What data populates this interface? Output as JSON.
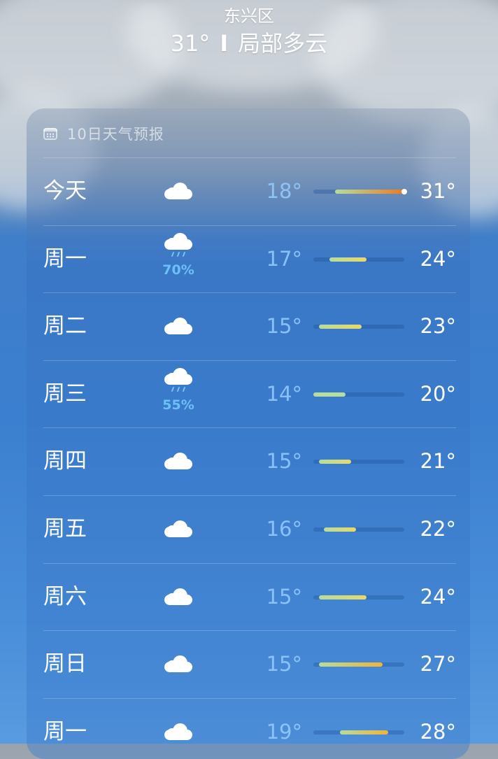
{
  "header": {
    "location": "东兴区",
    "current_temp": "31°",
    "separator": "I",
    "condition": "局部多云"
  },
  "forecast_card": {
    "icon": "calendar-icon",
    "title": "10日天气预报"
  },
  "days": [
    {
      "day": "今天",
      "icon": "cloud-icon",
      "precip": null,
      "low": "18°",
      "high": "31°",
      "low_value": 18,
      "high_value": 31,
      "current_value": 31
    },
    {
      "day": "周一",
      "icon": "cloud-rain-icon",
      "precip": "70%",
      "low": "17°",
      "high": "24°",
      "low_value": 17,
      "high_value": 24
    },
    {
      "day": "周二",
      "icon": "cloud-icon",
      "precip": null,
      "low": "15°",
      "high": "23°",
      "low_value": 15,
      "high_value": 23
    },
    {
      "day": "周三",
      "icon": "cloud-rain-icon",
      "precip": "55%",
      "low": "14°",
      "high": "20°",
      "low_value": 14,
      "high_value": 20
    },
    {
      "day": "周四",
      "icon": "cloud-icon",
      "precip": null,
      "low": "15°",
      "high": "21°",
      "low_value": 15,
      "high_value": 21
    },
    {
      "day": "周五",
      "icon": "cloud-icon",
      "precip": null,
      "low": "16°",
      "high": "22°",
      "low_value": 16,
      "high_value": 22
    },
    {
      "day": "周六",
      "icon": "cloud-icon",
      "precip": null,
      "low": "15°",
      "high": "24°",
      "low_value": 15,
      "high_value": 24
    },
    {
      "day": "周日",
      "icon": "cloud-icon",
      "precip": null,
      "low": "15°",
      "high": "27°",
      "low_value": 15,
      "high_value": 27
    },
    {
      "day": "周一",
      "icon": "cloud-icon",
      "precip": null,
      "low": "19°",
      "high": "28°",
      "low_value": 19,
      "high_value": 28
    }
  ],
  "range": {
    "min": 14,
    "max": 31
  },
  "colors": {
    "cool": "#b5dd9c",
    "mild": "#e8d86a",
    "warm": "#f4b23a",
    "hot": "#f07a1e",
    "precip": "#6cc0f7"
  }
}
